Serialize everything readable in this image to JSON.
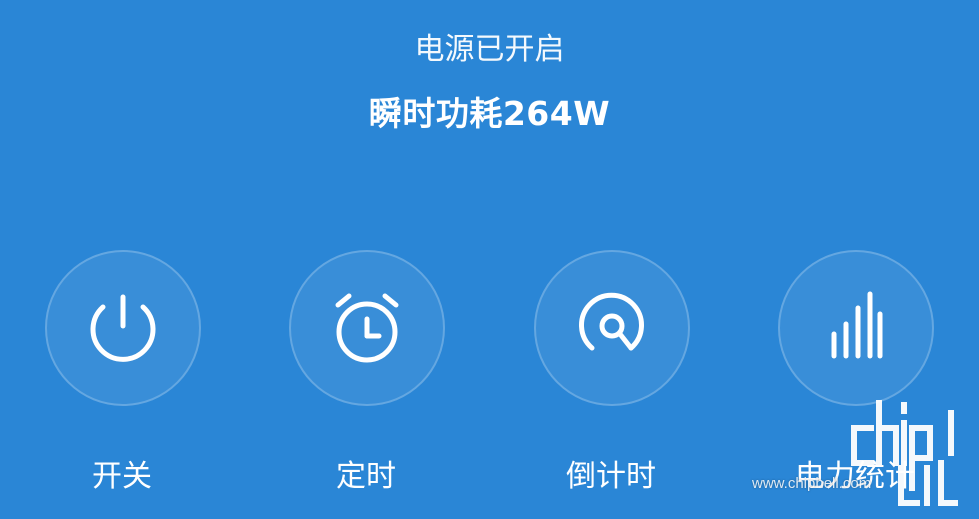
{
  "status": {
    "power_state": "电源已开启",
    "instant_power": "瞬时功耗264W"
  },
  "controls": [
    {
      "label": "开关",
      "icon": "power-icon"
    },
    {
      "label": "定时",
      "icon": "alarm-clock-icon"
    },
    {
      "label": "倒计时",
      "icon": "countdown-icon"
    },
    {
      "label": "电力统计",
      "icon": "bar-chart-icon"
    }
  ],
  "watermark": {
    "url_text": "www.chiphell.com"
  },
  "colors": {
    "background": "#2a86d6",
    "icon_stroke": "#ffffff"
  }
}
